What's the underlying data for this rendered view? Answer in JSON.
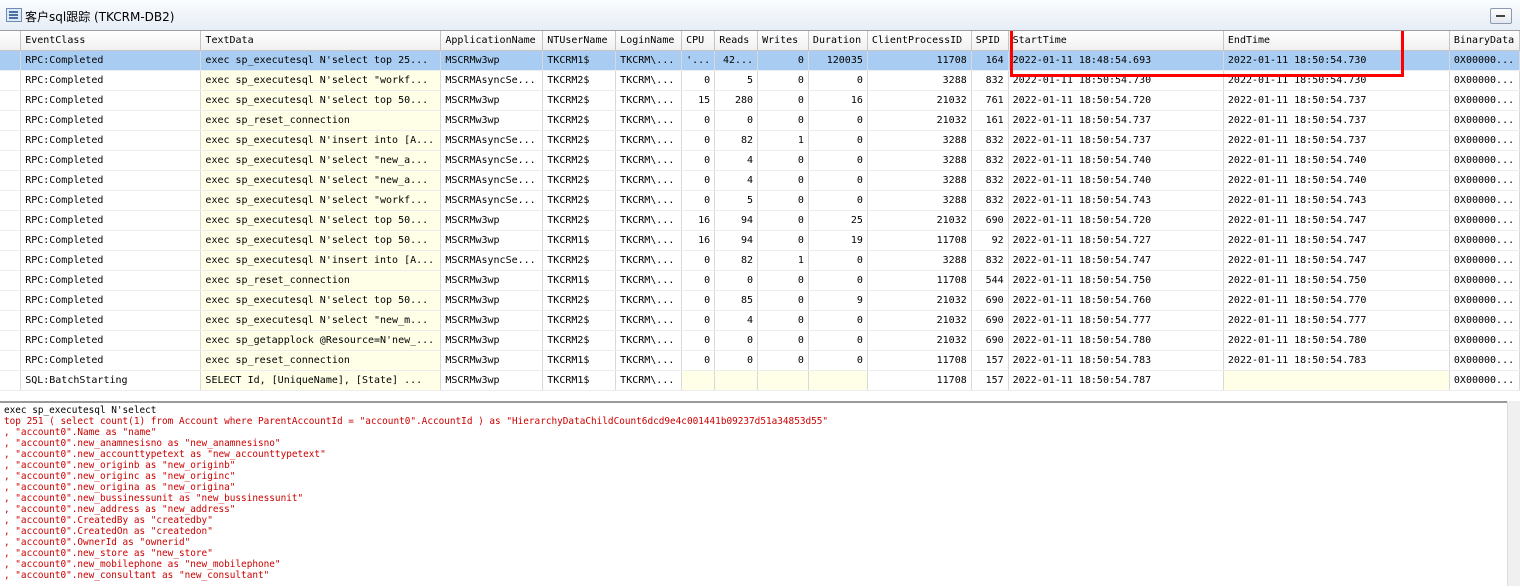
{
  "window": {
    "title": "客户sql跟踪 (TKCRM-DB2)"
  },
  "grid": {
    "columns": [
      "EventClass",
      "TextData",
      "ApplicationName",
      "NTUserName",
      "LoginName",
      "CPU",
      "Reads",
      "Writes",
      "Duration",
      "ClientProcessID",
      "SPID",
      "StartTime",
      "EndTime",
      "BinaryData"
    ],
    "highlight_color": "#ff0000",
    "selected_color": "#a9cdf2",
    "selected_row": 0,
    "rows": [
      [
        "RPC:Completed",
        "exec sp_executesql N'select  top 25...",
        "MSCRMw3wp",
        "TKCRM1$",
        "TKCRM\\...",
        "'...",
        "42...",
        "0",
        "120035",
        "11708",
        "164",
        "2022-01-11 18:48:54.693",
        "2022-01-11 18:50:54.730",
        "0X00000..."
      ],
      [
        "RPC:Completed",
        "exec sp_executesql N'select  \"workf...",
        "MSCRMAsyncSe...",
        "TKCRM2$",
        "TKCRM\\...",
        "0",
        "5",
        "0",
        "0",
        "3288",
        "832",
        "2022-01-11 18:50:54.730",
        "2022-01-11 18:50:54.730",
        "0X00000..."
      ],
      [
        "RPC:Completed",
        "exec sp_executesql N'select  top 50...",
        "MSCRMw3wp",
        "TKCRM2$",
        "TKCRM\\...",
        "15",
        "280",
        "0",
        "16",
        "21032",
        "761",
        "2022-01-11 18:50:54.720",
        "2022-01-11 18:50:54.737",
        "0X00000..."
      ],
      [
        "RPC:Completed",
        "exec sp_reset_connection",
        "MSCRMw3wp",
        "TKCRM2$",
        "TKCRM\\...",
        "0",
        "0",
        "0",
        "0",
        "21032",
        "161",
        "2022-01-11 18:50:54.737",
        "2022-01-11 18:50:54.737",
        "0X00000..."
      ],
      [
        "RPC:Completed",
        "exec sp_executesql N'insert into [A...",
        "MSCRMAsyncSe...",
        "TKCRM2$",
        "TKCRM\\...",
        "0",
        "82",
        "1",
        "0",
        "3288",
        "832",
        "2022-01-11 18:50:54.737",
        "2022-01-11 18:50:54.737",
        "0X00000..."
      ],
      [
        "RPC:Completed",
        "exec sp_executesql N'select  \"new_a...",
        "MSCRMAsyncSe...",
        "TKCRM2$",
        "TKCRM\\...",
        "0",
        "4",
        "0",
        "0",
        "3288",
        "832",
        "2022-01-11 18:50:54.740",
        "2022-01-11 18:50:54.740",
        "0X00000..."
      ],
      [
        "RPC:Completed",
        "exec sp_executesql N'select  \"new_a...",
        "MSCRMAsyncSe...",
        "TKCRM2$",
        "TKCRM\\...",
        "0",
        "4",
        "0",
        "0",
        "3288",
        "832",
        "2022-01-11 18:50:54.740",
        "2022-01-11 18:50:54.740",
        "0X00000..."
      ],
      [
        "RPC:Completed",
        "exec sp_executesql N'select  \"workf...",
        "MSCRMAsyncSe...",
        "TKCRM2$",
        "TKCRM\\...",
        "0",
        "5",
        "0",
        "0",
        "3288",
        "832",
        "2022-01-11 18:50:54.743",
        "2022-01-11 18:50:54.743",
        "0X00000..."
      ],
      [
        "RPC:Completed",
        "exec sp_executesql N'select  top 50...",
        "MSCRMw3wp",
        "TKCRM2$",
        "TKCRM\\...",
        "16",
        "94",
        "0",
        "25",
        "21032",
        "690",
        "2022-01-11 18:50:54.720",
        "2022-01-11 18:50:54.747",
        "0X00000..."
      ],
      [
        "RPC:Completed",
        "exec sp_executesql N'select  top 50...",
        "MSCRMw3wp",
        "TKCRM1$",
        "TKCRM\\...",
        "16",
        "94",
        "0",
        "19",
        "11708",
        "92",
        "2022-01-11 18:50:54.727",
        "2022-01-11 18:50:54.747",
        "0X00000..."
      ],
      [
        "RPC:Completed",
        "exec sp_executesql N'insert into [A...",
        "MSCRMAsyncSe...",
        "TKCRM2$",
        "TKCRM\\...",
        "0",
        "82",
        "1",
        "0",
        "3288",
        "832",
        "2022-01-11 18:50:54.747",
        "2022-01-11 18:50:54.747",
        "0X00000..."
      ],
      [
        "RPC:Completed",
        "exec sp_reset_connection",
        "MSCRMw3wp",
        "TKCRM1$",
        "TKCRM\\...",
        "0",
        "0",
        "0",
        "0",
        "11708",
        "544",
        "2022-01-11 18:50:54.750",
        "2022-01-11 18:50:54.750",
        "0X00000..."
      ],
      [
        "RPC:Completed",
        "exec sp_executesql N'select  top 50...",
        "MSCRMw3wp",
        "TKCRM2$",
        "TKCRM\\...",
        "0",
        "85",
        "0",
        "9",
        "21032",
        "690",
        "2022-01-11 18:50:54.760",
        "2022-01-11 18:50:54.770",
        "0X00000..."
      ],
      [
        "RPC:Completed",
        "exec sp_executesql N'select  \"new_m...",
        "MSCRMw3wp",
        "TKCRM2$",
        "TKCRM\\...",
        "0",
        "4",
        "0",
        "0",
        "21032",
        "690",
        "2022-01-11 18:50:54.777",
        "2022-01-11 18:50:54.777",
        "0X00000..."
      ],
      [
        "RPC:Completed",
        "exec sp_getapplock @Resource=N'new_...",
        "MSCRMw3wp",
        "TKCRM2$",
        "TKCRM\\...",
        "0",
        "0",
        "0",
        "0",
        "21032",
        "690",
        "2022-01-11 18:50:54.780",
        "2022-01-11 18:50:54.780",
        "0X00000..."
      ],
      [
        "RPC:Completed",
        "exec sp_reset_connection",
        "MSCRMw3wp",
        "TKCRM1$",
        "TKCRM\\...",
        "0",
        "0",
        "0",
        "0",
        "11708",
        "157",
        "2022-01-11 18:50:54.783",
        "2022-01-11 18:50:54.783",
        "0X00000..."
      ],
      [
        "SQL:BatchStarting",
        "SELECT  Id, [UniqueName], [State]  ...",
        "MSCRMw3wp",
        "TKCRM1$",
        "TKCRM\\...",
        "",
        "",
        "",
        "",
        "11708",
        "157",
        "2022-01-11 18:50:54.787",
        "",
        "0X00000..."
      ]
    ]
  },
  "detail": {
    "lines": [
      "exec sp_executesql N'select",
      "top 251 ( select count(1) from Account where ParentAccountId = \"account0\".AccountId ) as \"HierarchyDataChildCount6dcd9e4c001441b09237d51a34853d55\"",
      ", \"account0\".Name as \"name\"",
      ", \"account0\".new_anamnesisno as \"new_anamnesisno\"",
      ", \"account0\".new_accounttypetext as \"new_accounttypetext\"",
      ", \"account0\".new_originb as \"new_originb\"",
      ", \"account0\".new_originc as \"new_originc\"",
      ", \"account0\".new_origina as \"new_origina\"",
      ", \"account0\".new_bussinessunit as \"new_bussinessunit\"",
      ", \"account0\".new_address as \"new_address\"",
      ", \"account0\".CreatedBy as \"createdby\"",
      ", \"account0\".CreatedOn as \"createdon\"",
      ", \"account0\".OwnerId as \"ownerid\"",
      ", \"account0\".new_store as \"new_store\"",
      ", \"account0\".new_mobilephone as \"new_mobilephone\"",
      ", \"account0\".new_consultant as \"new_consultant\""
    ]
  }
}
